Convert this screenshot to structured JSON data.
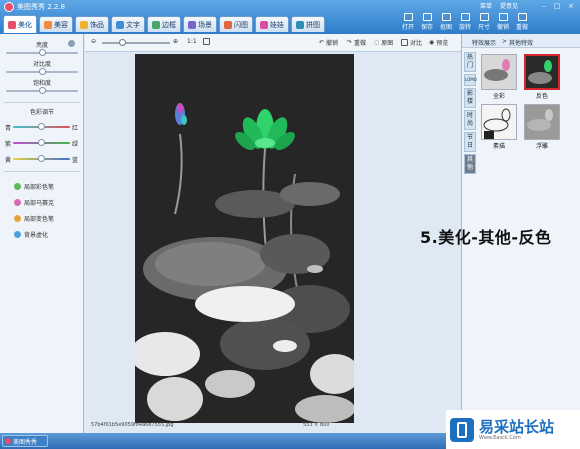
{
  "app": {
    "title": "美图秀秀 2.2.8"
  },
  "topmenu": {
    "menu": "菜单",
    "feedback": "提意见"
  },
  "tabs": [
    {
      "label": "美化",
      "color": "#e94f6a"
    },
    {
      "label": "美容",
      "color": "#f28b3c"
    },
    {
      "label": "饰品",
      "color": "#f0b32b"
    },
    {
      "label": "文字",
      "color": "#3c8fd6"
    },
    {
      "label": "边框",
      "color": "#4aa66a"
    },
    {
      "label": "场景",
      "color": "#7a63c9"
    },
    {
      "label": "闪图",
      "color": "#e0673b"
    },
    {
      "label": "娃娃",
      "color": "#d94ea0"
    },
    {
      "label": "拼图",
      "color": "#2d8fb3"
    }
  ],
  "toolbar": {
    "open": "打开",
    "save": "保存",
    "cut": "抠图",
    "rotate": "旋转",
    "size": "尺寸",
    "undo": "撤销",
    "redo": "重做"
  },
  "left": {
    "brightness": "亮度",
    "contrast": "对比度",
    "saturation": "饱和度",
    "color_adjust": "色彩调节",
    "cyan": "青",
    "red": "红",
    "purple": "紫",
    "green": "绿",
    "yellow": "黄",
    "blue": "蓝",
    "tools": [
      "局部彩色笔",
      "局部马赛克",
      "局部变色笔",
      "背景虚化"
    ],
    "brightness_level": 0.5,
    "contrast_level": 0.5,
    "saturation_level": 0.5
  },
  "zoombar": {
    "ratio": "1:1",
    "undo": "撤销",
    "redo": "重做",
    "original": "原图",
    "compare": "对比",
    "preview": "预览"
  },
  "status": {
    "filename": "57b4f01b5e9059f84a6e7555.jpg",
    "dimensions": "553 × 800"
  },
  "right": {
    "breadcrumb_a": "特效展示",
    "breadcrumb_b": "其他特效",
    "vtabs": [
      "热门",
      "LOMO",
      "影楼",
      "时尚",
      "节日",
      "其他"
    ],
    "effects": [
      "全彩",
      "反色",
      "素描",
      "浮雕"
    ]
  },
  "overlay": {
    "caption": "5.美化-其他-反色"
  },
  "taskbar": {
    "item": "美图秀秀"
  },
  "watermark": {
    "text": "易采站长站",
    "url": "Www.Easck.Com"
  }
}
